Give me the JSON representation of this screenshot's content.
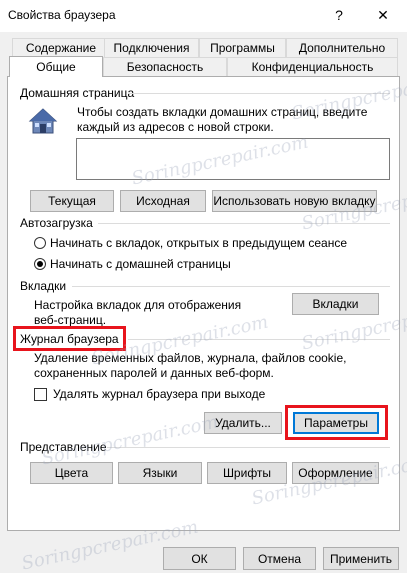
{
  "window": {
    "title": "Свойства браузера",
    "help_glyph": "?",
    "close_glyph": "✕"
  },
  "tabs": {
    "row1": [
      "Содержание",
      "Подключения",
      "Программы",
      "Дополнительно"
    ],
    "row2": [
      "Общие",
      "Безопасность",
      "Конфиденциальность"
    ],
    "active": "Общие"
  },
  "home": {
    "title": "Домашняя страница",
    "description": "Чтобы создать вкладки домашних страниц, введите каждый из адресов с новой строки.",
    "value": "",
    "buttons": [
      "Текущая",
      "Исходная",
      "Использовать новую вкладку"
    ]
  },
  "startup": {
    "title": "Автозагрузка",
    "options": [
      "Начинать с вкладок, открытых в предыдущем сеансе",
      "Начинать с домашней страницы"
    ],
    "selected_index": 1
  },
  "tabs_section": {
    "title": "Вкладки",
    "description": "Настройка вкладок для отображения веб-страниц.",
    "button": "Вкладки"
  },
  "history": {
    "title": "Журнал браузера",
    "description": "Удаление временных файлов, журнала, файлов cookie, сохраненных паролей и данных веб-форм.",
    "checkbox_label": "Удалять журнал браузера при выходе",
    "checkbox_checked": false,
    "delete_button": "Удалить...",
    "settings_button": "Параметры"
  },
  "appearance": {
    "title": "Представление",
    "buttons": [
      "Цвета",
      "Языки",
      "Шрифты",
      "Оформление"
    ]
  },
  "footer": {
    "ok": "ОК",
    "cancel": "Отмена",
    "apply": "Применить"
  },
  "watermark": "Soringpcrepair.com",
  "colors": {
    "highlight_red": "#e8141c",
    "focus_blue": "#0078d7"
  }
}
